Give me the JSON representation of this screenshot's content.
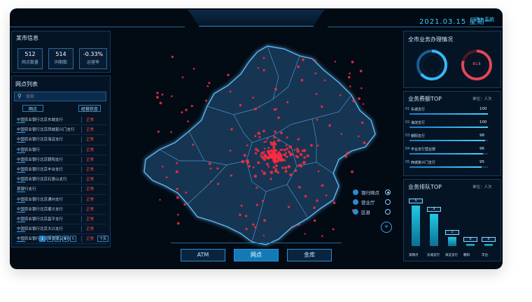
{
  "header": {
    "title": "",
    "date": "2021.03.15 星期一",
    "system_button": "进入系统"
  },
  "summary": {
    "title": "某市信息",
    "stats": [
      {
        "value": "512",
        "label": "网点数量"
      },
      {
        "value": "514",
        "label": "同期数"
      },
      {
        "value": "-0.33%",
        "label": "运营率"
      }
    ]
  },
  "outlets": {
    "title": "网点列表",
    "search_placeholder": "搜索",
    "col_name": "网点",
    "col_status": "经营状态",
    "rows": [
      {
        "name": "中国农业银行北京东城支行",
        "status": "正常"
      },
      {
        "name": "中国农业银行北京西城复兴门支行",
        "status": "正常"
      },
      {
        "name": "中国农业银行北京海淀支行",
        "status": "正常"
      },
      {
        "name": "中国农业银行",
        "status": "正常"
      },
      {
        "name": "中国农业银行北京朝阳支行",
        "status": "正常"
      },
      {
        "name": "中国农业银行北京丰台支行",
        "status": "正常"
      },
      {
        "name": "中国农业银行北京石景山支行",
        "status": "正常"
      },
      {
        "name": "某银行支行",
        "status": "正常"
      },
      {
        "name": "中国农业银行北京通州支行",
        "status": "正常"
      },
      {
        "name": "中国农业银行北京顺义支行",
        "status": "正常"
      },
      {
        "name": "中国农业银行北京昌平支行",
        "status": "正常"
      },
      {
        "name": "中国农业银行北京大兴支行",
        "status": "正常"
      },
      {
        "name": "中国农业银行北京怀柔密云支行",
        "status": "正常"
      }
    ],
    "pager": [
      "1",
      "2",
      "3",
      "4",
      "5",
      "下页"
    ]
  },
  "map": {
    "legend": [
      {
        "label": "银行网点",
        "selected": true
      },
      {
        "label": "营业厅",
        "selected": false
      },
      {
        "label": "区县",
        "selected": false
      }
    ]
  },
  "tabs": [
    {
      "label": "ATM",
      "active": false
    },
    {
      "label": "网点",
      "active": true
    },
    {
      "label": "金库",
      "active": false
    }
  ],
  "business_state": {
    "title": "全市业务办理情况",
    "gauges": [
      {
        "value": "",
        "label": ""
      },
      {
        "value": "81.8",
        "label": ""
      }
    ]
  },
  "business_top": {
    "title": "业务费额TOP",
    "unit": "单位：人次",
    "items": [
      {
        "idx": "01",
        "name": "东城支行",
        "value": "100",
        "fill": 1.0
      },
      {
        "idx": "02",
        "name": "海淀支行",
        "value": "100",
        "fill": 1.0
      },
      {
        "idx": "03",
        "name": "朝阳支行",
        "value": "98",
        "fill": 0.96
      },
      {
        "idx": "04",
        "name": "丰台支行营业部",
        "value": "96",
        "fill": 0.94
      },
      {
        "idx": "05",
        "name": "西城复兴门支行",
        "value": "95",
        "fill": 0.92
      }
    ]
  },
  "queue_top": {
    "title": "业务排队TOP",
    "unit": "单位：人次",
    "bars": [
      {
        "label": "某网点",
        "value": "5",
        "fill": 1.0
      },
      {
        "label": "东城支行",
        "value": "4",
        "fill": 0.8
      },
      {
        "label": "海淀支行",
        "value": "1",
        "fill": 0.22
      },
      {
        "label": "朝阳",
        "value": "0",
        "fill": 0.05
      },
      {
        "label": "丰台",
        "value": "0",
        "fill": 0.05
      }
    ]
  }
}
